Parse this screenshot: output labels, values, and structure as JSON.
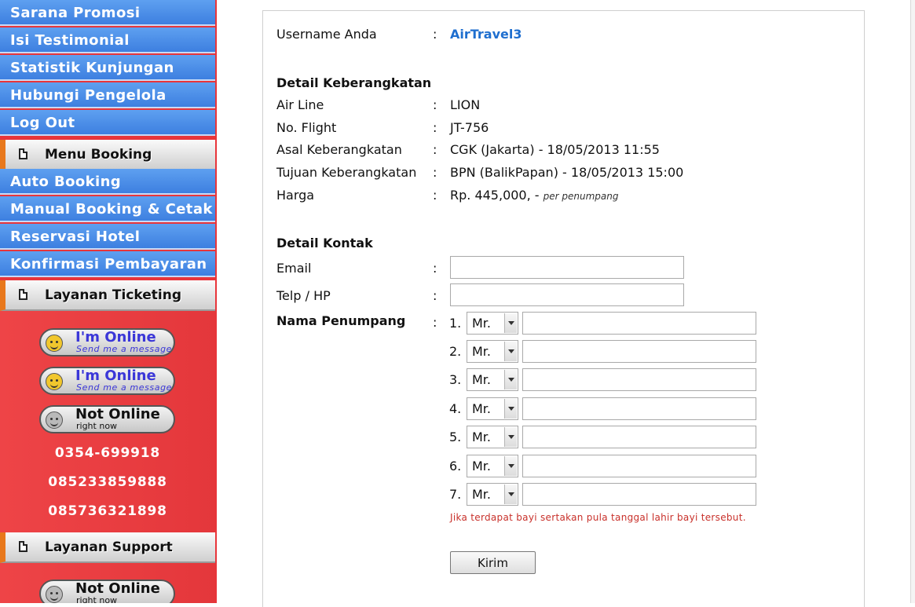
{
  "sidebar": {
    "top_items": [
      {
        "label": "Sarana Promosi"
      },
      {
        "label": "Isi Testimonial"
      },
      {
        "label": "Statistik Kunjungan"
      },
      {
        "label": "Hubungi Pengelola"
      },
      {
        "label": "Log Out"
      }
    ],
    "menu_booking_header": "Menu Booking",
    "booking_items": [
      {
        "label": "Auto Booking"
      },
      {
        "label": "Manual Booking & Cetak"
      },
      {
        "label": "Reservasi Hotel"
      },
      {
        "label": "Konfirmasi Pembayaran"
      }
    ],
    "ticketing_header": "Layanan Ticketing",
    "ticketing_badges": [
      {
        "line1": "I'm Online",
        "line2": "Send me a message",
        "status": "online"
      },
      {
        "line1": "I'm Online",
        "line2": "Send me a message",
        "status": "online"
      },
      {
        "line1": "Not Online",
        "line2": "right now",
        "status": "offline"
      }
    ],
    "phones": [
      "0354-699918",
      "085233859888",
      "085736321898"
    ],
    "support_header": "Layanan Support",
    "support_badges": [
      {
        "line1": "Not Online",
        "line2": "right now",
        "status": "offline"
      }
    ]
  },
  "form": {
    "username_label": "Username Anda",
    "username_value": "AirTravel3",
    "colon": ":",
    "departure_heading": "Detail Keberangkatan",
    "airline_label": "Air Line",
    "airline_value": "LION",
    "flight_label": "No. Flight",
    "flight_value": "JT-756",
    "origin_label": "Asal Keberangkatan",
    "origin_value": "CGK (Jakarta) - 18/05/2013 11:55",
    "destination_label": "Tujuan Keberangkatan",
    "destination_value": "BPN (BalikPapan) - 18/05/2013 15:00",
    "price_label": "Harga",
    "price_value": "Rp. 445,000, -",
    "price_note": "per penumpang",
    "contact_heading": "Detail Kontak",
    "email_label": "Email",
    "email_value": "",
    "phone_label": "Telp / HP",
    "phone_value": "",
    "passenger_label": "Nama Penumpang",
    "passengers": [
      {
        "number": "1.",
        "title": "Mr.",
        "name": ""
      },
      {
        "number": "2.",
        "title": "Mr.",
        "name": ""
      },
      {
        "number": "3.",
        "title": "Mr.",
        "name": ""
      },
      {
        "number": "4.",
        "title": "Mr.",
        "name": ""
      },
      {
        "number": "5.",
        "title": "Mr.",
        "name": ""
      },
      {
        "number": "6.",
        "title": "Mr.",
        "name": ""
      },
      {
        "number": "7.",
        "title": "Mr.",
        "name": ""
      }
    ],
    "infant_note": "Jika terdapat bayi sertakan pula tanggal lahir bayi tersebut.",
    "submit_label": "Kirim"
  },
  "colors": {
    "sidebar_blue": "#4a8be8",
    "sidebar_red": "#e8353a",
    "accent_orange": "#e8781c",
    "link_blue": "#1f6fcf",
    "note_red": "#c8302a"
  }
}
